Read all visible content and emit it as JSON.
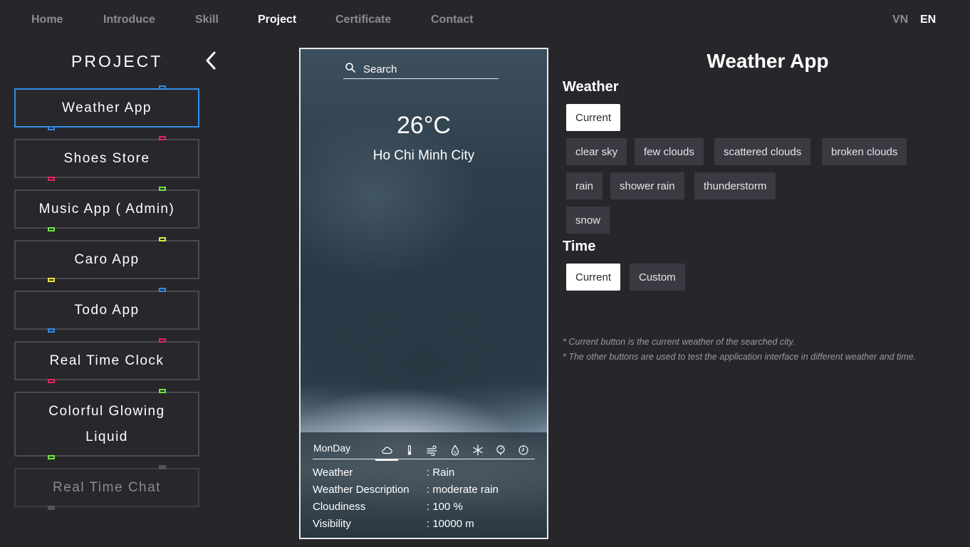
{
  "nav": {
    "items": [
      "Home",
      "Introduce",
      "Skill",
      "Project",
      "Certificate",
      "Contact"
    ],
    "active": "Project",
    "languages": [
      "VN",
      "EN"
    ],
    "active_language": "EN"
  },
  "sidebar": {
    "title": "PROJECT",
    "projects": [
      {
        "label": "Weather App",
        "tick_color": "#2f8fe6"
      },
      {
        "label": "Shoes Store",
        "tick_color": "#e5245e"
      },
      {
        "label": "Music App ( Admin)",
        "tick_color": "#6be83b"
      },
      {
        "label": "Caro App",
        "tick_color": "#e4e83b"
      },
      {
        "label": "Todo App",
        "tick_color": "#2f8fe6"
      },
      {
        "label": "Real Time Clock",
        "tick_color": "#e5245e"
      },
      {
        "label": "Colorful Glowing Liquid",
        "tick_color": "#6be83b"
      },
      {
        "label": "Real Time Chat",
        "tick_color": "#6a6a6e"
      }
    ]
  },
  "preview": {
    "search_placeholder": "Search",
    "temperature": "26°C",
    "city": "Ho Chi Minh City",
    "day": "MonDay",
    "icons": [
      "cloud-icon",
      "thermometer-icon",
      "wind-icon",
      "humidity-icon",
      "snowflake-icon",
      "pressure-icon",
      "clock-icon"
    ],
    "rows": [
      {
        "label": "Weather",
        "value": ": Rain"
      },
      {
        "label": "Weather Description",
        "value": ": moderate rain"
      },
      {
        "label": "Cloudiness",
        "value": ": 100 %"
      },
      {
        "label": "Visibility",
        "value": ": 10000 m"
      }
    ]
  },
  "detail": {
    "title": "Weather App",
    "weather_label": "Weather",
    "weather_buttons": [
      "Current",
      "clear sky",
      "few clouds",
      "scattered clouds",
      "broken clouds",
      "rain",
      "shower rain",
      "thunderstorm",
      "snow"
    ],
    "time_label": "Time",
    "time_buttons": [
      "Current",
      "Custom"
    ],
    "notes": [
      "* Current button is the current weather of the searched city.",
      "* The other buttons are used to test the application interface in different weather and time."
    ]
  },
  "colors": {
    "background": "#27262b",
    "active_border": "#2f8fe6",
    "chip": "#3a3b42"
  }
}
